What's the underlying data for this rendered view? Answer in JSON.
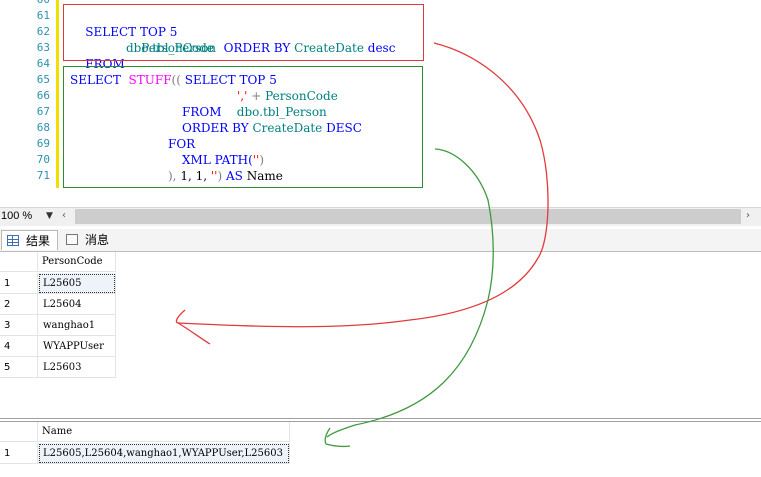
{
  "editor": {
    "line_numbers": [
      "60",
      "61",
      "62",
      "63",
      "64",
      "65",
      "66",
      "67",
      "68",
      "69",
      "70",
      "71"
    ],
    "query1": {
      "line1_kw": "SELECT TOP 5",
      "line2_col": "PersonCode",
      "line3_kw": "FROM",
      "line3_table": "dbo.tbl_Person",
      "line3_order": "ORDER BY",
      "line3_col": "CreateDate",
      "line3_dir": "desc"
    },
    "query2": {
      "l65_select": "SELECT",
      "l65_stuff": "STUFF",
      "l65_paren": "((",
      "l65_inner": "SELECT TOP 5",
      "l66_str": "','",
      "l66_plus": "+",
      "l66_col": "PersonCode",
      "l67_from": "FROM",
      "l67_table": "dbo.tbl_Person",
      "l68_order": "ORDER BY",
      "l68_col": "CreateDate",
      "l68_dir": "DESC",
      "l69_for": "FOR",
      "l70_xml": "XML PATH(",
      "l70_str": "''",
      "l70_close": ")",
      "l71_close": "),",
      "l71_args": "1, 1,",
      "l71_str": "''",
      "l71_paren": ")",
      "l71_as": "AS",
      "l71_alias": "Name"
    }
  },
  "zoom": {
    "value": "100 %",
    "dropdown_icon": "chevron-down-icon"
  },
  "scroll": {
    "left_arrow": "‹",
    "right_arrow": "›"
  },
  "tabs": {
    "results": "结果",
    "messages": "消息"
  },
  "results1": {
    "columns": [
      "PersonCode"
    ],
    "rows": [
      {
        "num": "1",
        "value": "L25605"
      },
      {
        "num": "2",
        "value": "L25604"
      },
      {
        "num": "3",
        "value": "wanghao1"
      },
      {
        "num": "4",
        "value": "WYAPPUser"
      },
      {
        "num": "5",
        "value": "L25603"
      }
    ]
  },
  "results2": {
    "columns": [
      "Name"
    ],
    "rows": [
      {
        "num": "1",
        "value": "L25605,L25604,wanghao1,WYAPPUser,L25603"
      }
    ]
  },
  "colors": {
    "keyword": "#0000ff",
    "function": "#ff00ff",
    "identifier": "#008080",
    "string": "#ff0000",
    "line_number": "#2b91af",
    "annotation_red": "#e23b3b",
    "annotation_green": "#3f9a3f"
  }
}
